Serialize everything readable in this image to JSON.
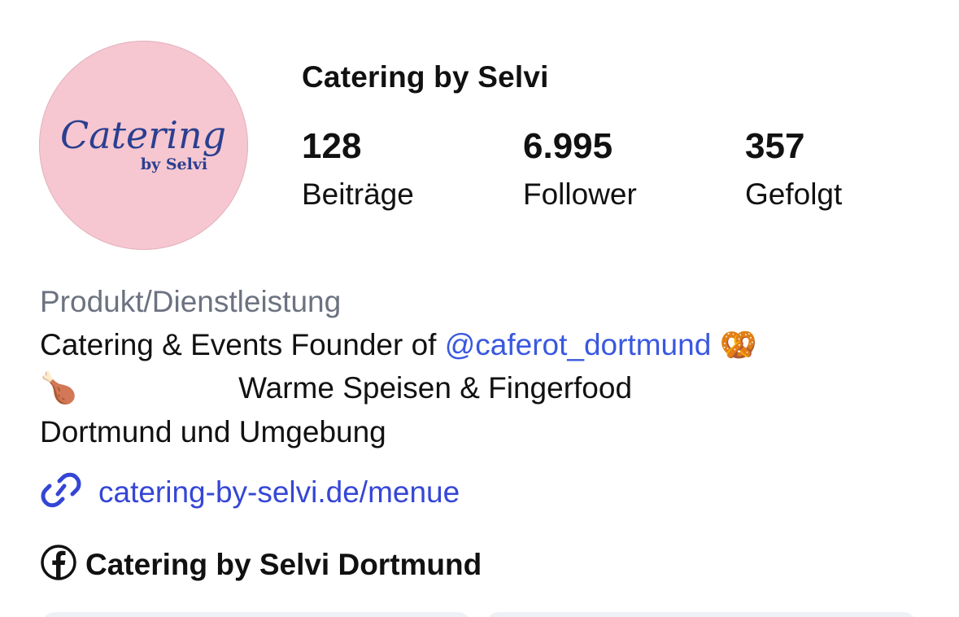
{
  "profile": {
    "name": "Catering by Selvi",
    "avatar_logo_line1": "Catering",
    "avatar_logo_line2": "by Selvi"
  },
  "stats": [
    {
      "value": "128",
      "label": "Beiträge"
    },
    {
      "value": "6.995",
      "label": "Follower"
    },
    {
      "value": "357",
      "label": "Gefolgt"
    }
  ],
  "bio": {
    "category": "Produkt/Dienstleistung",
    "line1_prefix": "Catering & Events Founder of ",
    "line1_mention": "@caferot_dortmund",
    "line1_emoji": "🥨",
    "line2_emoji": "🍗",
    "line2_text": "Warme Speisen & Fingerfood",
    "line3_text": "Dortmund und Umgebung"
  },
  "link": {
    "icon": "link-icon",
    "text": "catering-by-selvi.de/menue"
  },
  "facebook": {
    "icon": "facebook-icon",
    "text": "Catering by Selvi Dortmund"
  },
  "colors": {
    "avatar_bg": "#f6c7d1",
    "logo_text": "#2b3f8f",
    "mention": "#3a58e0",
    "link": "#3546d6",
    "category": "#6c7280"
  }
}
